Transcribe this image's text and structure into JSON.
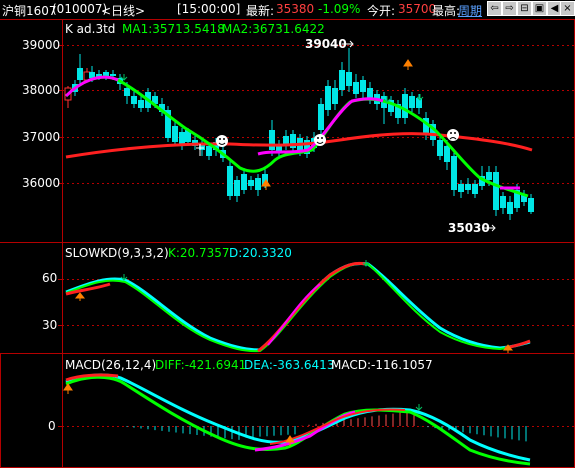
{
  "header": {
    "contract": "沪铜1607",
    "code": "(010007)",
    "period": "<日线>",
    "time": "[15:00:00]",
    "latest_label": "最新:",
    "latest_value": "35380",
    "change_pct": "-1.09%",
    "open_label": "今开:",
    "open_value": "35700",
    "high_label": "最高:",
    "cycle_link": "周期",
    "buttons": [
      "⇦",
      "⇨",
      "⊟",
      "▣",
      "◀",
      "×"
    ]
  },
  "main_panel": {
    "indicator_name": "K ad.3td",
    "ma1": "MA1:35713.5418",
    "ma2": "MA2:36731.6422",
    "y_ticks": [
      "39000",
      "38000",
      "37000",
      "36000"
    ],
    "annotation_high": "39040",
    "annotation_low": "35030"
  },
  "kd_panel": {
    "name": "SLOWKD(9,3,3,2)",
    "k": "K:20.7357",
    "d": "D:20.3320",
    "y_ticks": [
      "60",
      "30"
    ]
  },
  "macd_panel": {
    "name": "MACD(26,12,4)",
    "diff": "DIFF:-421.6941",
    "dea": "DEA:-363.6413",
    "macd": "MACD:-116.1057",
    "y_ticks": [
      "0"
    ]
  },
  "colors": {
    "up": "#ff3232",
    "down": "#00e6e6",
    "ma1": "#00ff00",
    "ma2": "#ff2020",
    "accent": "#ff00ff",
    "grid": "#b40000"
  }
}
